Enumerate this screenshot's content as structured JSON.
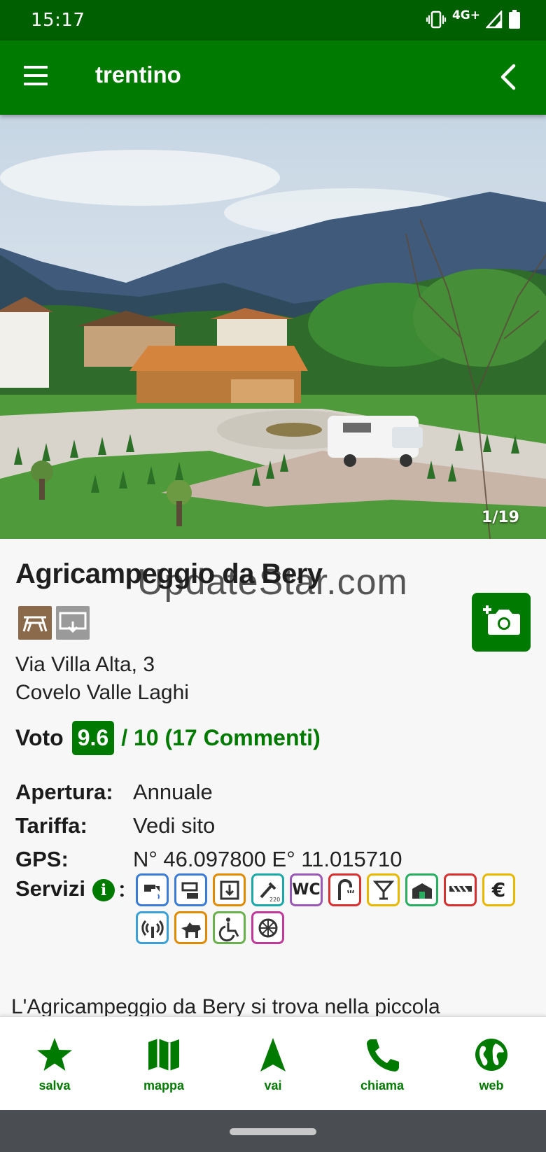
{
  "status_bar": {
    "time": "15:17",
    "network": "4G+"
  },
  "app_bar": {
    "title": "trentino"
  },
  "gallery": {
    "counter": "1/19"
  },
  "place": {
    "name": "Agricampeggio da Bery",
    "watermark": "UpdateStar.com",
    "address_line1": "Via Villa Alta, 3",
    "address_line2": "Covelo Valle Laghi"
  },
  "rating": {
    "label": "Voto",
    "score": "9.6",
    "rest": "/ 10 (17 Commenti)"
  },
  "info": [
    {
      "label": "Apertura:",
      "value": "Annuale"
    },
    {
      "label": "Tariffa:",
      "value": "Vedi sito"
    },
    {
      "label": "GPS:",
      "value": "N° 46.097800 E° 11.015710"
    }
  ],
  "services": {
    "label": "Servizi",
    "colon": ":",
    "items": [
      {
        "icon": "water-tap-icon",
        "color": "#3a7bd5"
      },
      {
        "icon": "drain-icon",
        "color": "#3a7bd5"
      },
      {
        "icon": "waste-disposal-icon",
        "color": "#e08a00"
      },
      {
        "icon": "electricity-220-icon",
        "color": "#1aa8a8"
      },
      {
        "icon": "wc-icon",
        "color": "#9b59b6",
        "text": "WC"
      },
      {
        "icon": "shower-icon",
        "color": "#d63031"
      },
      {
        "icon": "drink-bar-icon",
        "color": "#e6b800"
      },
      {
        "icon": "shop-icon",
        "color": "#27ae60"
      },
      {
        "icon": "barrier-icon",
        "color": "#d63031"
      },
      {
        "icon": "euro-icon",
        "color": "#e6b800",
        "text": "€"
      },
      {
        "icon": "wifi-icon",
        "color": "#3aa0d5"
      },
      {
        "icon": "dog-icon",
        "color": "#e08a00"
      },
      {
        "icon": "wheelchair-icon",
        "color": "#6ab04c"
      },
      {
        "icon": "playground-icon",
        "color": "#c0399b"
      }
    ]
  },
  "description": "L'Agricampeggio da Bery si trova nella piccola",
  "bottom_nav": [
    {
      "label": "salva",
      "icon": "star-icon"
    },
    {
      "label": "mappa",
      "icon": "map-icon"
    },
    {
      "label": "vai",
      "icon": "navigation-icon"
    },
    {
      "label": "chiama",
      "icon": "phone-icon"
    },
    {
      "label": "web",
      "icon": "globe-icon"
    }
  ]
}
